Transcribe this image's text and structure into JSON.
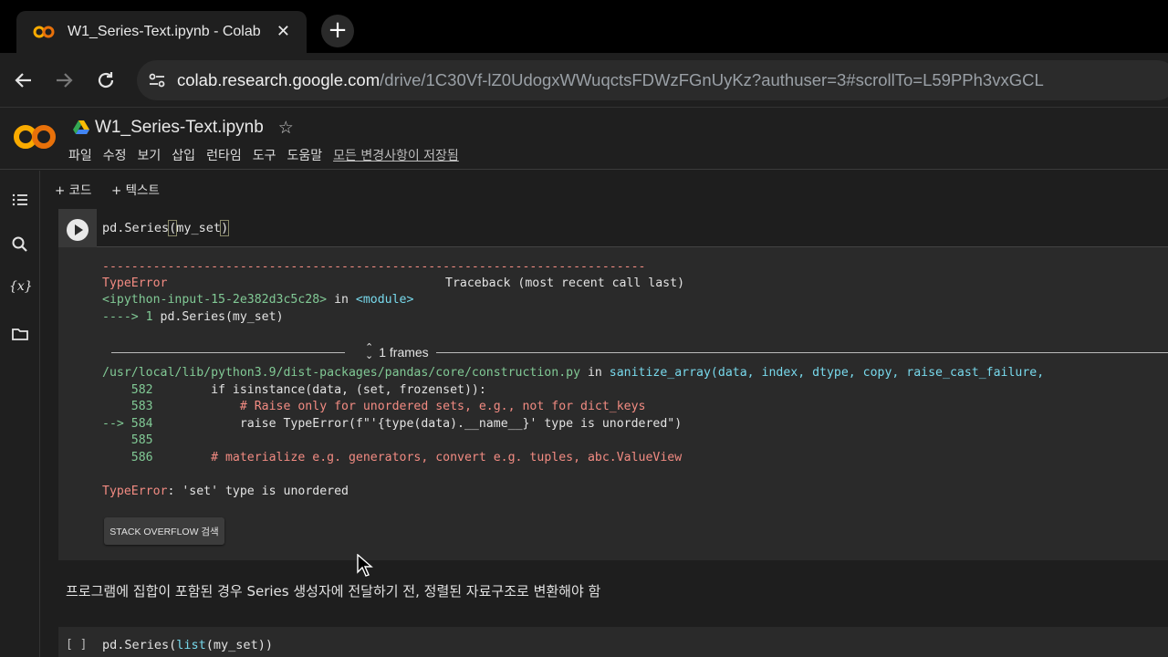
{
  "browser": {
    "tab_title": "W1_Series-Text.ipynb - Colab",
    "tab_close": "✕",
    "new_tab": "+",
    "url_host": "colab.research.google.com",
    "url_path": "/drive/1C30Vf-lZ0UdogxWWuqctsFDWzFGnUyKz?authuser=3#scrollTo=L59PPh3vxGCL"
  },
  "colab": {
    "notebook_title": "W1_Series-Text.ipynb",
    "star": "☆",
    "menus": [
      "파일",
      "수정",
      "보기",
      "삽입",
      "런타임",
      "도구",
      "도움말"
    ],
    "saved_status": "모든 변경사항이 저장됨",
    "add_code": "+ 코드",
    "add_text": "+ 텍스트",
    "rail_var_icon": "{x}"
  },
  "cell1": {
    "code_prefix": "pd.Series",
    "code_open": "(",
    "code_arg": "my_set",
    "code_close": ")"
  },
  "traceback": {
    "dashes": "---------------------------------------------------------------------------",
    "error_name": "TypeError",
    "traceback_header": "Traceback (most recent call last)",
    "input_ref": "<ipython-input-15-2e382d3c5c28>",
    "in_word": " in ",
    "module": "<module>",
    "arrow_line_prefix": "----> 1 ",
    "arrow_line_code": "pd.Series(my_set)",
    "frames_label": "1 frames",
    "file_path": "/usr/local/lib/python3.9/dist-packages/pandas/core/construction.py",
    "func_sig": "sanitize_array(data, index, dtype, copy, raise_cast_failure,",
    "line_582_no": "    582",
    "line_582_code": "        if isinstance(data, (set, frozenset)):",
    "line_583_no": "    583",
    "line_583_code": "            # Raise only for unordered sets, e.g., not for dict_keys",
    "line_584_no": "--> 584",
    "line_584_code_a": "            raise TypeError(f\"'",
    "line_584_code_b": "{type(data).__name__}",
    "line_584_code_c": "' type is unordered\")",
    "line_585_no": "    585",
    "line_586_no": "    586",
    "line_586_code": "        # materialize e.g. generators, convert e.g. tuples, abc.ValueView",
    "final_error_name": "TypeError",
    "final_error_msg": ": 'set' type is unordered",
    "so_button": "STACK OVERFLOW 검색"
  },
  "text_cell": {
    "content": "프로그램에 집합이 포함된 경우 Series 생성자에 전달하기 전, 정렬된 자료구조로 변환해야 함"
  },
  "cell2": {
    "bracket": "[ ]",
    "code_prefix": "pd.Series(",
    "code_inner": "list",
    "code_mid": "(my_set)",
    "code_close": ")"
  }
}
